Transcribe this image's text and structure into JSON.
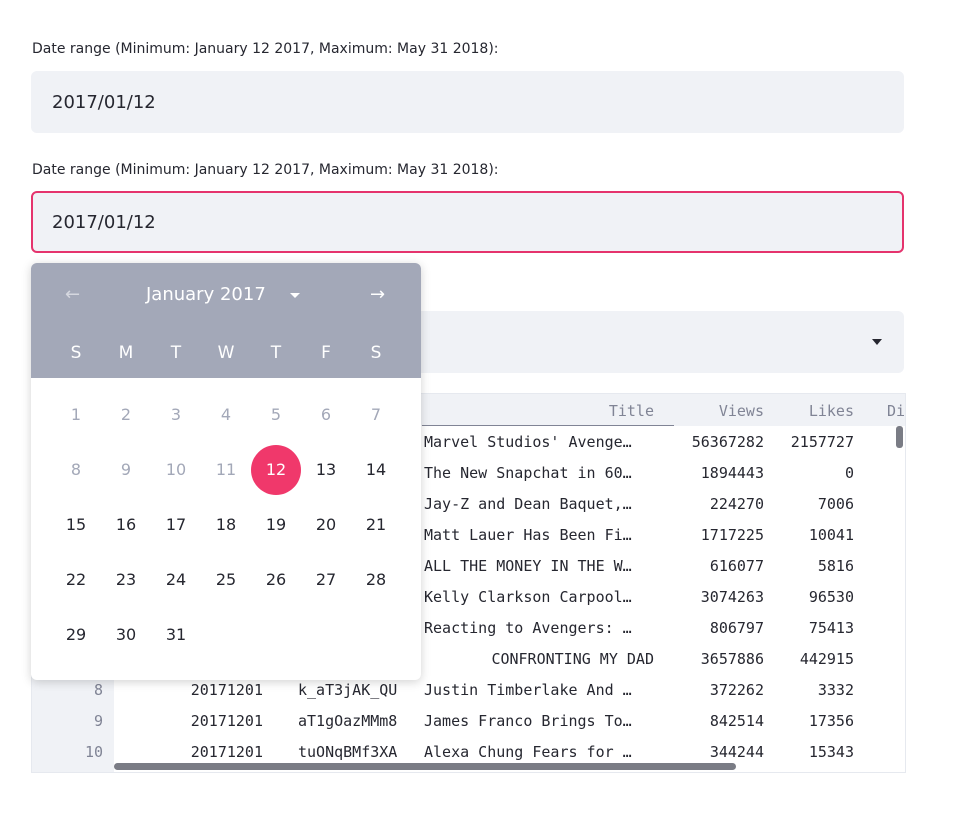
{
  "date_input_1": {
    "label": "Date range (Minimum: January 12 2017, Maximum: May 31 2018):",
    "value": "2017/01/12"
  },
  "date_input_2": {
    "label": "Date range (Minimum: January 12 2017, Maximum: May 31 2018):",
    "value": "2017/01/12"
  },
  "calendar": {
    "month_label": "January 2017",
    "prev_icon": "arrow-left-icon",
    "next_icon": "arrow-right-icon",
    "weekdays": [
      "S",
      "M",
      "T",
      "W",
      "T",
      "F",
      "S"
    ],
    "selected_day": "12",
    "muted_days": [
      "1",
      "2",
      "3",
      "4",
      "5",
      "6",
      "7",
      "8",
      "9",
      "10",
      "11"
    ],
    "weeks": [
      [
        "1",
        "2",
        "3",
        "4",
        "5",
        "6",
        "7"
      ],
      [
        "8",
        "9",
        "10",
        "11",
        "12",
        "13",
        "14"
      ],
      [
        "15",
        "16",
        "17",
        "18",
        "19",
        "20",
        "21"
      ],
      [
        "22",
        "23",
        "24",
        "25",
        "26",
        "27",
        "28"
      ],
      [
        "29",
        "30",
        "31",
        "",
        "",
        "",
        ""
      ]
    ],
    "colors": {
      "header": "#a3a8b8",
      "selected": "#f0386b",
      "focus_border": "#e5336d"
    }
  },
  "table": {
    "columns": [
      "Title",
      "Views",
      "Likes",
      "Di"
    ],
    "rows": [
      {
        "idx": "",
        "date": "",
        "id": "",
        "title": "Marvel Studios' Avenge…",
        "views": "56367282",
        "likes": "2157727"
      },
      {
        "idx": "",
        "date": "",
        "id": "",
        "title": "The New Snapchat in 60…",
        "views": "1894443",
        "likes": "0"
      },
      {
        "idx": "",
        "date": "",
        "id": "",
        "title": "Jay-Z and Dean Baquet,…",
        "views": "224270",
        "likes": "7006"
      },
      {
        "idx": "",
        "date": "",
        "id": "",
        "title": "Matt Lauer Has Been Fi…",
        "views": "1717225",
        "likes": "10041"
      },
      {
        "idx": "",
        "date": "",
        "id": "",
        "title": "ALL THE MONEY IN THE W…",
        "views": "616077",
        "likes": "5816"
      },
      {
        "idx": "",
        "date": "",
        "id": "",
        "title": "Kelly Clarkson Carpool…",
        "views": "3074263",
        "likes": "96530"
      },
      {
        "idx": "",
        "date": "",
        "id": "",
        "title": "Reacting to Avengers: …",
        "views": "806797",
        "likes": "75413"
      },
      {
        "idx": "",
        "date": "",
        "id": "",
        "title": "CONFRONTING MY DAD",
        "views": "3657886",
        "likes": "442915"
      },
      {
        "idx": "8",
        "date": "20171201",
        "id": "k_aT3jAK_QU",
        "title": "Justin Timberlake And …",
        "views": "372262",
        "likes": "3332"
      },
      {
        "idx": "9",
        "date": "20171201",
        "id": "aT1gOazMMm8",
        "title": "James Franco Brings To…",
        "views": "842514",
        "likes": "17356"
      },
      {
        "idx": "10",
        "date": "20171201",
        "id": "tuONqBMf3XA",
        "title": "Alexa Chung Fears for …",
        "views": "344244",
        "likes": "15343"
      }
    ]
  }
}
